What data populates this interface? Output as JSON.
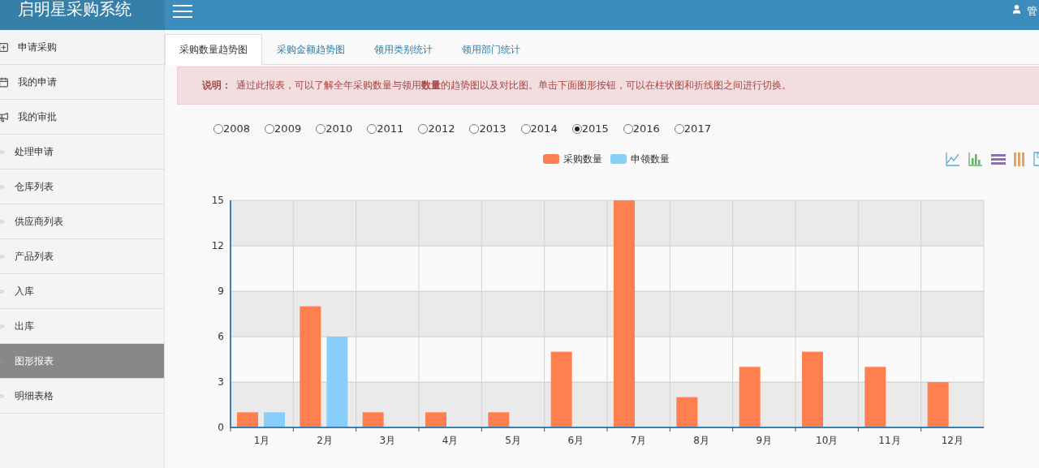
{
  "header": {
    "brand": "启明星采购系统",
    "user": "管"
  },
  "sidebar": {
    "items": [
      {
        "label": "申请采购",
        "kind": "plus",
        "selected": false
      },
      {
        "label": "我的申请",
        "kind": "calendar",
        "selected": false
      },
      {
        "label": "我的审批",
        "kind": "megaphone",
        "selected": false
      },
      {
        "label": "处理申请",
        "kind": "chevron",
        "selected": false
      },
      {
        "label": "仓库列表",
        "kind": "chevron",
        "selected": false
      },
      {
        "label": "供应商列表",
        "kind": "chevron",
        "selected": false
      },
      {
        "label": "产品列表",
        "kind": "chevron",
        "selected": false
      },
      {
        "label": "入库",
        "kind": "chevron",
        "selected": false
      },
      {
        "label": "出库",
        "kind": "chevron",
        "selected": false
      },
      {
        "label": "图形报表",
        "kind": "chevron",
        "selected": true
      },
      {
        "label": "明细表格",
        "kind": "chevron",
        "selected": false
      }
    ]
  },
  "tabs": [
    {
      "label": "采购数量趋势图",
      "selected": true
    },
    {
      "label": "采购金额趋势图",
      "selected": false
    },
    {
      "label": "领用类别统计",
      "selected": false
    },
    {
      "label": "领用部门统计",
      "selected": false
    }
  ],
  "notice": {
    "label": "说明：",
    "text": "通过此报表，可以了解全年采购数量与领用**数量**的趋势图以及对比图。单击下面图形按钮，可以在柱状图和折线图之间进行切换。"
  },
  "years": [
    {
      "label": "2008",
      "selected": false
    },
    {
      "label": "2009",
      "selected": false
    },
    {
      "label": "2010",
      "selected": false
    },
    {
      "label": "2011",
      "selected": false
    },
    {
      "label": "2012",
      "selected": false
    },
    {
      "label": "2013",
      "selected": false
    },
    {
      "label": "2014",
      "selected": false
    },
    {
      "label": "2015",
      "selected": true
    },
    {
      "label": "2016",
      "selected": false
    },
    {
      "label": "2017",
      "selected": false
    }
  ],
  "chart": {
    "toolbox": [
      {
        "kind": "line"
      },
      {
        "kind": "bar"
      },
      {
        "kind": "stack"
      },
      {
        "kind": "tiled"
      },
      {
        "kind": "save"
      }
    ],
    "chart_data": {
      "type": "bar",
      "categories": [
        "1月",
        "2月",
        "3月",
        "4月",
        "5月",
        "6月",
        "7月",
        "8月",
        "9月",
        "10月",
        "11月",
        "12月"
      ],
      "ylim": [
        0,
        15
      ],
      "yticks": [
        0,
        3,
        6,
        9,
        12,
        15
      ],
      "series": [
        {
          "name": "采购数量",
          "color": "#ff7f50",
          "values": [
            1,
            8,
            1,
            1,
            1,
            5,
            15,
            2,
            4,
            5,
            4,
            3
          ]
        },
        {
          "name": "申领数量",
          "color": "#87cefa",
          "values": [
            1,
            6,
            0,
            0,
            0,
            0,
            0,
            0,
            0,
            0,
            0,
            0
          ]
        }
      ]
    }
  }
}
